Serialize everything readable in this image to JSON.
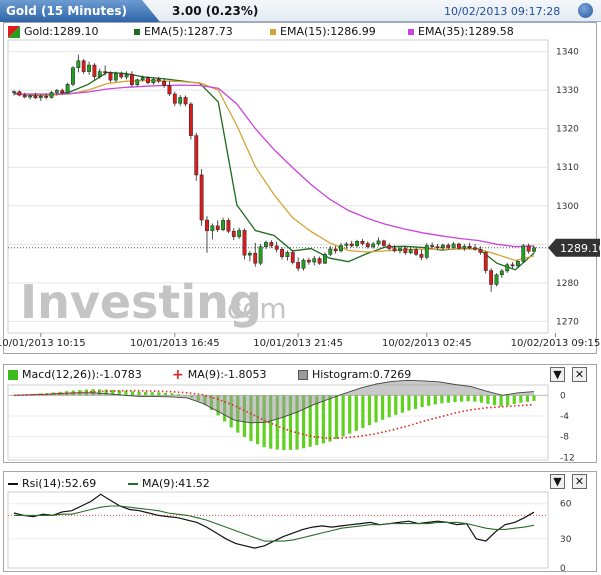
{
  "header": {
    "title": "Gold (15 Minutes)",
    "change": "3.00 (0.23%)",
    "datetime": "10/02/2013 09:17:28"
  },
  "colors": {
    "bull": "#22a022",
    "bear": "#dd1c1c",
    "ema5": "#1d6b1d",
    "ema15": "#d4a33a",
    "ema35": "#cc44dd",
    "macd_hist": "#5fd11f",
    "macd_signal": "#e02424",
    "rsi": "#111111",
    "rsi_ma": "#2a6a2a"
  },
  "main_legend": {
    "price": "Gold:1289.10",
    "ema5": "EMA(5):1287.73",
    "ema15": "EMA(15):1286.99",
    "ema35": "EMA(35):1289.58"
  },
  "watermark": {
    "brand": "Investing",
    "suffix": ".com"
  },
  "last_price_label": "1289.10",
  "macd_legend": {
    "macd": "Macd(12,26)):-1.0783",
    "signal": "MA(9):-1.8053",
    "histogram": "Histogram:0.7269"
  },
  "rsi_legend": {
    "rsi": "Rsi(14):52.69",
    "ma": "MA(9):41.52"
  },
  "controls": {
    "collapse": "▼",
    "close": "✕"
  },
  "chart_data": [
    {
      "type": "candlestick",
      "title": "Gold (15 Minutes)",
      "ylim": [
        1267,
        1343
      ],
      "y_ticks": [
        1340,
        1330,
        1320,
        1310,
        1300,
        1290,
        1280,
        1270
      ],
      "x_tick_labels": [
        "10/01/2013 10:15",
        "10/01/2013 16:45",
        "10/01/2013 21:45",
        "10/02/2013 02:45",
        "10/02/2013 09:15"
      ],
      "x_tick_index": [
        5,
        30,
        53,
        77,
        101
      ],
      "candles": [
        {
          "o": 1329.4,
          "h": 1330.0,
          "l": 1328.6,
          "c": 1329.6
        },
        {
          "o": 1329.6,
          "h": 1329.9,
          "l": 1328.4,
          "c": 1328.7
        },
        {
          "o": 1328.7,
          "h": 1329.3,
          "l": 1327.9,
          "c": 1328.2
        },
        {
          "o": 1328.2,
          "h": 1328.9,
          "l": 1327.6,
          "c": 1328.5
        },
        {
          "o": 1328.5,
          "h": 1329.3,
          "l": 1327.7,
          "c": 1328.0
        },
        {
          "o": 1328.0,
          "h": 1328.9,
          "l": 1327.2,
          "c": 1328.4
        },
        {
          "o": 1328.4,
          "h": 1329.1,
          "l": 1327.6,
          "c": 1328.1
        },
        {
          "o": 1328.1,
          "h": 1329.8,
          "l": 1327.8,
          "c": 1329.4
        },
        {
          "o": 1329.4,
          "h": 1330.3,
          "l": 1328.6,
          "c": 1329.9
        },
        {
          "o": 1329.9,
          "h": 1330.4,
          "l": 1328.9,
          "c": 1329.3
        },
        {
          "o": 1329.3,
          "h": 1331.9,
          "l": 1329.0,
          "c": 1331.5
        },
        {
          "o": 1331.5,
          "h": 1336.2,
          "l": 1331.0,
          "c": 1335.8
        },
        {
          "o": 1335.8,
          "h": 1339.2,
          "l": 1334.6,
          "c": 1337.6
        },
        {
          "o": 1337.6,
          "h": 1338.1,
          "l": 1334.2,
          "c": 1334.8
        },
        {
          "o": 1334.8,
          "h": 1337.4,
          "l": 1334.0,
          "c": 1336.5
        },
        {
          "o": 1336.5,
          "h": 1337.0,
          "l": 1332.8,
          "c": 1333.5
        },
        {
          "o": 1333.5,
          "h": 1335.6,
          "l": 1333.0,
          "c": 1334.8
        },
        {
          "o": 1334.8,
          "h": 1336.4,
          "l": 1333.8,
          "c": 1334.5
        },
        {
          "o": 1334.5,
          "h": 1334.9,
          "l": 1332.0,
          "c": 1332.6
        },
        {
          "o": 1332.6,
          "h": 1334.8,
          "l": 1332.1,
          "c": 1334.2
        },
        {
          "o": 1334.2,
          "h": 1334.8,
          "l": 1332.9,
          "c": 1333.4
        },
        {
          "o": 1333.4,
          "h": 1334.9,
          "l": 1332.8,
          "c": 1334.1
        },
        {
          "o": 1334.1,
          "h": 1334.9,
          "l": 1330.8,
          "c": 1331.4
        },
        {
          "o": 1331.4,
          "h": 1333.0,
          "l": 1330.9,
          "c": 1332.7
        },
        {
          "o": 1332.7,
          "h": 1333.8,
          "l": 1332.2,
          "c": 1333.2
        },
        {
          "o": 1333.2,
          "h": 1333.6,
          "l": 1331.5,
          "c": 1331.9
        },
        {
          "o": 1331.9,
          "h": 1333.3,
          "l": 1331.4,
          "c": 1332.8
        },
        {
          "o": 1332.8,
          "h": 1333.4,
          "l": 1331.8,
          "c": 1332.3
        },
        {
          "o": 1332.3,
          "h": 1333.1,
          "l": 1330.6,
          "c": 1331.2
        },
        {
          "o": 1331.2,
          "h": 1332.3,
          "l": 1328.5,
          "c": 1329.0
        },
        {
          "o": 1329.0,
          "h": 1329.6,
          "l": 1325.8,
          "c": 1326.6
        },
        {
          "o": 1326.6,
          "h": 1328.7,
          "l": 1325.9,
          "c": 1328.1
        },
        {
          "o": 1328.1,
          "h": 1328.6,
          "l": 1325.8,
          "c": 1326.4
        },
        {
          "o": 1326.4,
          "h": 1326.9,
          "l": 1317.2,
          "c": 1318.2
        },
        {
          "o": 1318.2,
          "h": 1318.9,
          "l": 1306.5,
          "c": 1308.0
        },
        {
          "o": 1308.0,
          "h": 1309.5,
          "l": 1294.8,
          "c": 1296.3
        },
        {
          "o": 1296.3,
          "h": 1297.3,
          "l": 1287.8,
          "c": 1293.5
        },
        {
          "o": 1293.5,
          "h": 1295.4,
          "l": 1291.3,
          "c": 1294.8
        },
        {
          "o": 1294.8,
          "h": 1296.2,
          "l": 1293.2,
          "c": 1293.8
        },
        {
          "o": 1293.8,
          "h": 1296.9,
          "l": 1293.4,
          "c": 1296.2
        },
        {
          "o": 1296.2,
          "h": 1296.8,
          "l": 1292.9,
          "c": 1293.4
        },
        {
          "o": 1293.4,
          "h": 1294.2,
          "l": 1291.1,
          "c": 1292.0
        },
        {
          "o": 1292.0,
          "h": 1294.3,
          "l": 1291.4,
          "c": 1293.6
        },
        {
          "o": 1293.6,
          "h": 1294.1,
          "l": 1286.1,
          "c": 1287.2
        },
        {
          "o": 1287.2,
          "h": 1288.3,
          "l": 1285.6,
          "c": 1287.7
        },
        {
          "o": 1287.7,
          "h": 1290.4,
          "l": 1284.2,
          "c": 1285.1
        },
        {
          "o": 1285.1,
          "h": 1290.1,
          "l": 1284.6,
          "c": 1289.4
        },
        {
          "o": 1289.4,
          "h": 1291.0,
          "l": 1288.8,
          "c": 1290.5
        },
        {
          "o": 1290.5,
          "h": 1291.1,
          "l": 1289.0,
          "c": 1289.6
        },
        {
          "o": 1289.6,
          "h": 1290.7,
          "l": 1287.9,
          "c": 1288.7
        },
        {
          "o": 1288.7,
          "h": 1289.2,
          "l": 1286.1,
          "c": 1286.8
        },
        {
          "o": 1286.8,
          "h": 1288.4,
          "l": 1285.8,
          "c": 1287.9
        },
        {
          "o": 1287.9,
          "h": 1288.5,
          "l": 1284.8,
          "c": 1285.3
        },
        {
          "o": 1285.3,
          "h": 1286.6,
          "l": 1283.0,
          "c": 1283.8
        },
        {
          "o": 1283.8,
          "h": 1286.4,
          "l": 1283.2,
          "c": 1285.9
        },
        {
          "o": 1285.9,
          "h": 1286.5,
          "l": 1284.7,
          "c": 1285.4
        },
        {
          "o": 1285.4,
          "h": 1287.0,
          "l": 1284.5,
          "c": 1286.3
        },
        {
          "o": 1286.3,
          "h": 1286.8,
          "l": 1284.7,
          "c": 1285.1
        },
        {
          "o": 1285.1,
          "h": 1287.9,
          "l": 1284.9,
          "c": 1287.4
        },
        {
          "o": 1287.4,
          "h": 1289.6,
          "l": 1286.9,
          "c": 1288.8
        },
        {
          "o": 1288.8,
          "h": 1289.6,
          "l": 1287.6,
          "c": 1288.3
        },
        {
          "o": 1288.3,
          "h": 1290.4,
          "l": 1287.9,
          "c": 1289.7
        },
        {
          "o": 1289.7,
          "h": 1290.6,
          "l": 1288.8,
          "c": 1290.1
        },
        {
          "o": 1290.1,
          "h": 1290.9,
          "l": 1289.2,
          "c": 1289.6
        },
        {
          "o": 1289.6,
          "h": 1291.2,
          "l": 1289.2,
          "c": 1290.8
        },
        {
          "o": 1290.8,
          "h": 1291.4,
          "l": 1289.7,
          "c": 1290.2
        },
        {
          "o": 1290.2,
          "h": 1290.8,
          "l": 1288.9,
          "c": 1289.4
        },
        {
          "o": 1289.4,
          "h": 1290.6,
          "l": 1288.9,
          "c": 1290.1
        },
        {
          "o": 1290.1,
          "h": 1291.8,
          "l": 1289.6,
          "c": 1290.9
        },
        {
          "o": 1290.9,
          "h": 1291.2,
          "l": 1289.2,
          "c": 1289.7
        },
        {
          "o": 1289.7,
          "h": 1290.3,
          "l": 1288.4,
          "c": 1288.9
        },
        {
          "o": 1288.9,
          "h": 1289.8,
          "l": 1287.9,
          "c": 1288.3
        },
        {
          "o": 1288.3,
          "h": 1289.3,
          "l": 1287.6,
          "c": 1288.9
        },
        {
          "o": 1288.9,
          "h": 1289.4,
          "l": 1287.3,
          "c": 1287.8
        },
        {
          "o": 1287.8,
          "h": 1289.1,
          "l": 1287.4,
          "c": 1288.6
        },
        {
          "o": 1288.6,
          "h": 1289.1,
          "l": 1286.9,
          "c": 1287.4
        },
        {
          "o": 1287.4,
          "h": 1288.7,
          "l": 1285.9,
          "c": 1286.6
        },
        {
          "o": 1286.6,
          "h": 1290.3,
          "l": 1286.1,
          "c": 1289.7
        },
        {
          "o": 1289.7,
          "h": 1290.5,
          "l": 1288.9,
          "c": 1289.4
        },
        {
          "o": 1289.4,
          "h": 1290.1,
          "l": 1288.6,
          "c": 1289.1
        },
        {
          "o": 1289.1,
          "h": 1290.2,
          "l": 1288.4,
          "c": 1289.8
        },
        {
          "o": 1289.8,
          "h": 1290.3,
          "l": 1288.7,
          "c": 1289.2
        },
        {
          "o": 1289.2,
          "h": 1290.6,
          "l": 1288.9,
          "c": 1290.1
        },
        {
          "o": 1290.1,
          "h": 1290.4,
          "l": 1288.6,
          "c": 1289.0
        },
        {
          "o": 1289.0,
          "h": 1290.1,
          "l": 1288.3,
          "c": 1289.5
        },
        {
          "o": 1289.5,
          "h": 1290.4,
          "l": 1288.7,
          "c": 1289.1
        },
        {
          "o": 1289.1,
          "h": 1290.1,
          "l": 1288.3,
          "c": 1288.7
        },
        {
          "o": 1288.7,
          "h": 1289.5,
          "l": 1287.3,
          "c": 1287.9
        },
        {
          "o": 1287.9,
          "h": 1288.3,
          "l": 1282.4,
          "c": 1283.2
        },
        {
          "o": 1283.2,
          "h": 1283.8,
          "l": 1277.7,
          "c": 1279.6
        },
        {
          "o": 1279.6,
          "h": 1282.5,
          "l": 1279.1,
          "c": 1282.1
        },
        {
          "o": 1282.1,
          "h": 1283.6,
          "l": 1281.3,
          "c": 1283.1
        },
        {
          "o": 1283.1,
          "h": 1285.2,
          "l": 1282.6,
          "c": 1284.7
        },
        {
          "o": 1284.7,
          "h": 1285.4,
          "l": 1283.8,
          "c": 1284.4
        },
        {
          "o": 1284.4,
          "h": 1285.9,
          "l": 1283.9,
          "c": 1285.6
        },
        {
          "o": 1285.6,
          "h": 1290.1,
          "l": 1285.2,
          "c": 1289.6
        },
        {
          "o": 1289.6,
          "h": 1290.2,
          "l": 1287.6,
          "c": 1288.2
        },
        {
          "o": 1288.2,
          "h": 1289.7,
          "l": 1287.7,
          "c": 1289.1
        }
      ],
      "series": [
        {
          "name": "EMA(5)",
          "color_key": "ema5",
          "sampled": [
            1329.2,
            1328.6,
            1328.7,
            1329.5,
            1331.5,
            1334.6,
            1334.3,
            1333.4,
            1333.0,
            1332.4,
            1331.8,
            1326.9,
            1300.2,
            1293.6,
            1292.3,
            1288.3,
            1288.9,
            1286.4,
            1285.5,
            1287.6,
            1289.3,
            1289.5,
            1289.2,
            1288.5,
            1288.9,
            1288.9,
            1285.1,
            1283.4,
            1287.73
          ]
        },
        {
          "name": "EMA(15)",
          "color_key": "ema15",
          "sampled": [
            1329.0,
            1328.8,
            1328.7,
            1329.0,
            1330.0,
            1331.7,
            1332.3,
            1332.5,
            1332.4,
            1332.2,
            1331.9,
            1330.0,
            1320.8,
            1310.1,
            1302.9,
            1296.9,
            1293.3,
            1290.4,
            1288.4,
            1288.0,
            1288.3,
            1288.6,
            1288.8,
            1288.7,
            1288.8,
            1288.8,
            1287.4,
            1285.8,
            1286.99
          ]
        },
        {
          "name": "EMA(35)",
          "color_key": "ema35",
          "sampled": [
            1329.0,
            1329.0,
            1329.0,
            1329.1,
            1329.5,
            1330.3,
            1330.7,
            1331.0,
            1331.2,
            1331.3,
            1331.2,
            1330.5,
            1326.4,
            1320.0,
            1314.6,
            1309.9,
            1305.5,
            1301.7,
            1298.8,
            1296.8,
            1295.2,
            1294.0,
            1293.0,
            1292.2,
            1291.5,
            1291.0,
            1290.0,
            1289.4,
            1289.58
          ]
        }
      ],
      "last_price": 1289.1
    },
    {
      "type": "bar",
      "title": "MACD",
      "ylim": [
        -12.5,
        2
      ],
      "y_ticks": [
        0,
        -4,
        -8,
        -12
      ],
      "series": [
        {
          "name": "Macd(12,26))",
          "color_key": "rsi",
          "values": [
            0.0,
            0.2,
            0.4,
            0.7,
            1.0,
            1.2,
            1.1,
            0.9,
            0.7,
            0.6,
            0.4,
            0.0,
            -1.5,
            -4.0,
            -6.8,
            -8.8,
            -10.2,
            -10.6,
            -10.5,
            -9.8,
            -9.0,
            -7.8,
            -6.5,
            -5.2,
            -4.0,
            -3.0,
            -2.2,
            -1.6,
            -1.3,
            -1.1,
            -1.6,
            -2.2,
            -1.5,
            -1.08
          ]
        },
        {
          "name": "MA(9)",
          "color_key": "macd_signal",
          "values": [
            0.0,
            0.1,
            0.2,
            0.3,
            0.5,
            0.7,
            0.8,
            0.9,
            0.9,
            0.8,
            0.7,
            0.5,
            0.1,
            -0.8,
            -2.0,
            -3.5,
            -5.0,
            -6.3,
            -7.3,
            -8.0,
            -8.3,
            -8.2,
            -7.9,
            -7.4,
            -6.7,
            -5.9,
            -5.0,
            -4.2,
            -3.4,
            -2.8,
            -2.4,
            -2.2,
            -2.0,
            -1.81
          ]
        },
        {
          "name": "Histogram",
          "color_key": "macd_hist",
          "values": [
            0.0,
            0.1,
            0.2,
            0.4,
            0.5,
            0.5,
            0.3,
            0.0,
            -0.2,
            -0.2,
            -0.3,
            -0.5,
            -1.6,
            -3.2,
            -4.8,
            -5.3,
            -5.2,
            -4.3,
            -3.2,
            -1.8,
            -0.7,
            0.4,
            1.4,
            2.2,
            2.7,
            2.9,
            2.8,
            2.6,
            2.1,
            1.7,
            0.8,
            0.0,
            0.5,
            0.73
          ]
        }
      ]
    },
    {
      "type": "line",
      "title": "RSI",
      "ylim": [
        5,
        70
      ],
      "y_ticks": [
        60,
        30,
        0
      ],
      "reference_line": 50,
      "series": [
        {
          "name": "Rsi(14)",
          "color_key": "rsi",
          "values": [
            52,
            50,
            49,
            51,
            50,
            53,
            54,
            58,
            62,
            68,
            63,
            58,
            55,
            54,
            52,
            50,
            49,
            48,
            46,
            44,
            40,
            35,
            30,
            26,
            24,
            22,
            24,
            28,
            32,
            35,
            38,
            40,
            41,
            40,
            41,
            42,
            43,
            44,
            42,
            43,
            44,
            45,
            43,
            44,
            45,
            44,
            42,
            43,
            30,
            28,
            36,
            42,
            44,
            48,
            52.69
          ]
        },
        {
          "name": "MA(9)",
          "color_key": "rsi_ma",
          "values": [
            50,
            50,
            50,
            50,
            50,
            51,
            51,
            53,
            55,
            57,
            58,
            58,
            57,
            56,
            55,
            54,
            52,
            51,
            50,
            48,
            46,
            43,
            40,
            37,
            34,
            31,
            28,
            28,
            28,
            29,
            31,
            33,
            35,
            37,
            39,
            40,
            41,
            42,
            42,
            43,
            43,
            43,
            43,
            43,
            44,
            44,
            44,
            43,
            41,
            39,
            38,
            38,
            39,
            40,
            41.52
          ]
        }
      ]
    }
  ]
}
